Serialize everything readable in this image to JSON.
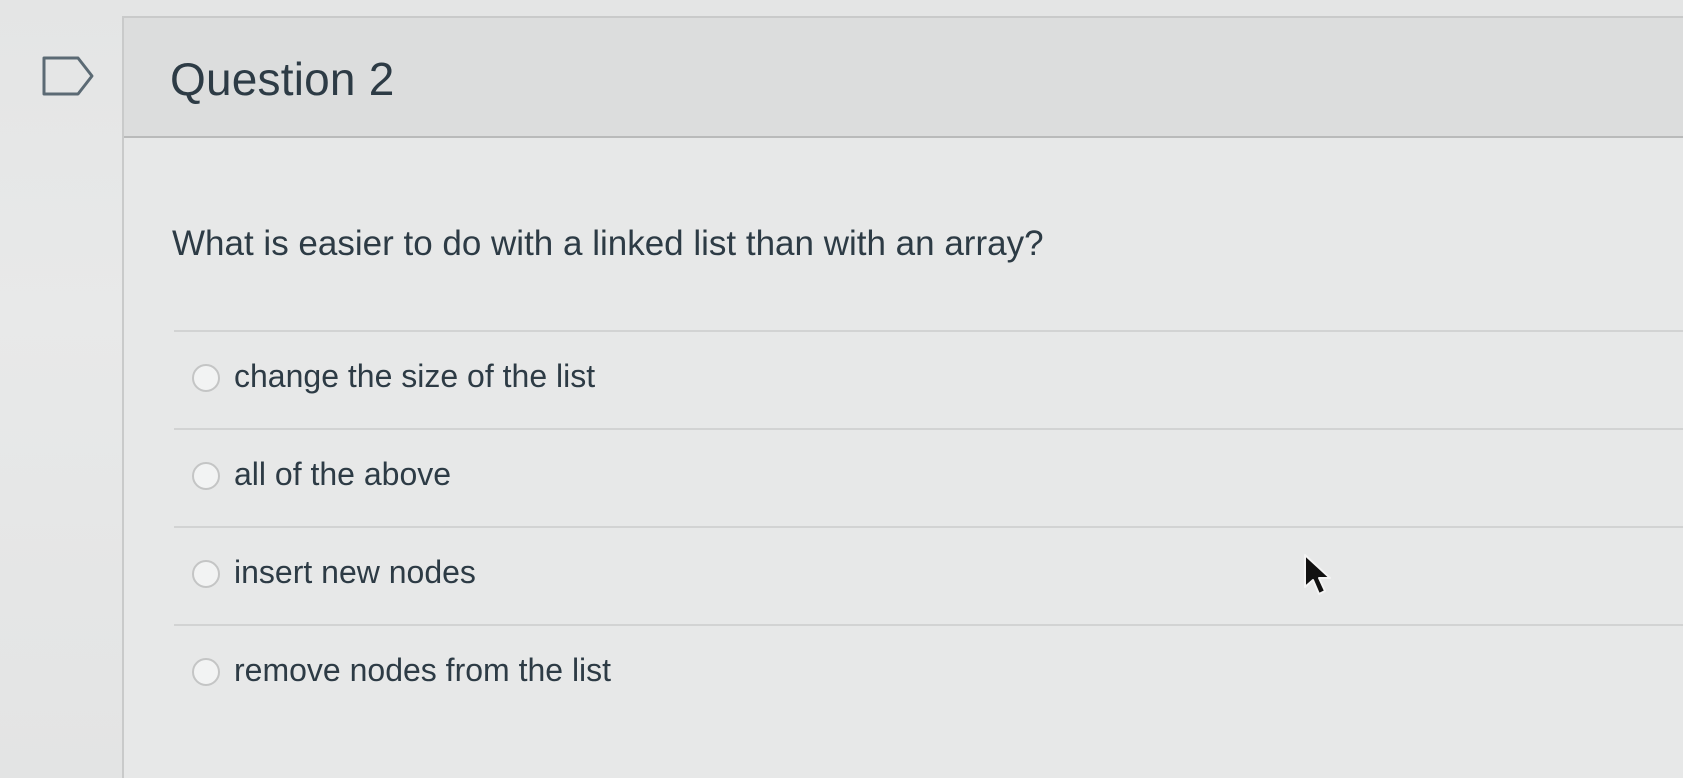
{
  "question": {
    "title": "Question 2",
    "text": "What is easier to do with a linked list than with an array?",
    "answers": [
      {
        "label": "change the size of the list"
      },
      {
        "label": "all of the above"
      },
      {
        "label": "insert new nodes"
      },
      {
        "label": "remove nodes from the list"
      }
    ]
  },
  "icons": {
    "flag": "flag-question-icon",
    "cursor": "mouse-pointer-icon"
  }
}
